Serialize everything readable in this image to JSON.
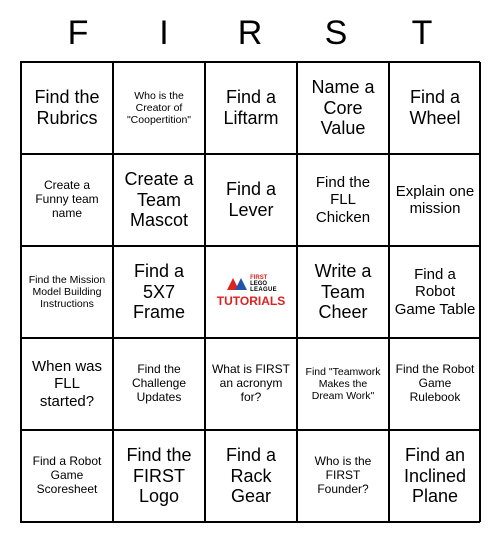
{
  "header": [
    "F",
    "I",
    "R",
    "S",
    "T"
  ],
  "grid": [
    [
      {
        "text": "Find the Rubrics",
        "size": "lg"
      },
      {
        "text": "Who is the Creator of \"Coopertition\"",
        "size": "xs"
      },
      {
        "text": "Find a Liftarm",
        "size": "lg"
      },
      {
        "text": "Name a Core Value",
        "size": "lg"
      },
      {
        "text": "Find a Wheel",
        "size": "lg"
      }
    ],
    [
      {
        "text": "Create a Funny team name",
        "size": "sm"
      },
      {
        "text": "Create a Team Mascot",
        "size": "lg"
      },
      {
        "text": "Find a Lever",
        "size": "lg"
      },
      {
        "text": "Find the FLL Chicken",
        "size": "md"
      },
      {
        "text": "Explain one mission",
        "size": "md"
      }
    ],
    [
      {
        "text": "Find the Mission Model Building Instructions",
        "size": "xs"
      },
      {
        "text": "Find a 5X7 Frame",
        "size": "lg"
      },
      {
        "text": "",
        "size": "center"
      },
      {
        "text": "Write a Team Cheer",
        "size": "lg"
      },
      {
        "text": "Find a Robot Game Table",
        "size": "md"
      }
    ],
    [
      {
        "text": "When was FLL started?",
        "size": "md"
      },
      {
        "text": "Find the Challenge Updates",
        "size": "sm"
      },
      {
        "text": "What is FIRST an acronym for?",
        "size": "sm"
      },
      {
        "text": "Find \"Teamwork Makes the Dream Work\"",
        "size": "xs"
      },
      {
        "text": "Find the Robot Game Rulebook",
        "size": "sm"
      }
    ],
    [
      {
        "text": "Find a Robot Game Scoresheet",
        "size": "sm"
      },
      {
        "text": "Find the FIRST Logo",
        "size": "lg"
      },
      {
        "text": "Find a Rack Gear",
        "size": "lg"
      },
      {
        "text": "Who is the FIRST Founder?",
        "size": "sm"
      },
      {
        "text": "Find an Inclined Plane",
        "size": "lg"
      }
    ]
  ],
  "center": {
    "line1": "FIRST",
    "line2": "LEGO",
    "line3": "LEAGUE",
    "tutorials": "TUTORIALS"
  }
}
